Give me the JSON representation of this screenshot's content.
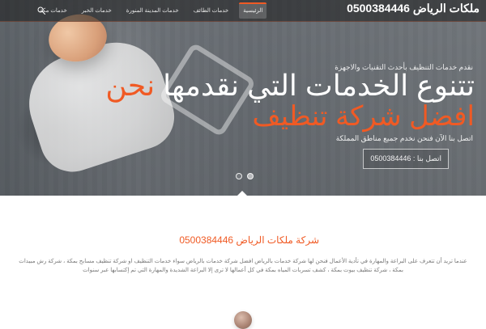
{
  "header": {
    "brand_name": "ملكات الرياض",
    "brand_phone": "0500384446",
    "nav": [
      {
        "label": "الرئيسية",
        "active": true
      },
      {
        "label": "خدمات الطائف",
        "active": false
      },
      {
        "label": "خدمات المدينة المنورة",
        "active": false
      },
      {
        "label": "خدمات الخبر",
        "active": false
      },
      {
        "label": "خدمات مكة",
        "active": false
      }
    ],
    "search_icon": "search-icon"
  },
  "hero": {
    "kicker": "نقدم خدمات التنظيف بأحدث التقنيات والاجهزة",
    "title_line1_pre": "تتنوع الخدمات التي نقدمها ",
    "title_line1_accent": "نحن",
    "title_line2": "افضل شركة تنظيف",
    "subtitle": "اتصل بنا الآن فنحن نخدم جميع مناطق المملكة",
    "cta_label": "اتصل بنا : 0500384446",
    "slider_dots": [
      {
        "active": false
      },
      {
        "active": true
      }
    ]
  },
  "about": {
    "title": "شركة ملكات الرياض 0500384446",
    "paragraph": "عندما تريد أن تتعرف على البراعة والمهارة في تأدية الأعمال فنحن لها شركة خدمات بالرياض افضل شركة خدمات بالرياض سواء خدمات التنظيف او شركة تنظيف مسابح بمكة ، شركة رش مبيدات بمكة ، شركة تنظيف بيوت بمكة ، كشف تسربات المياه بمكة في كل أعمالها لا ترى إلا البراعة الشديدة والمهارة التي تم إكتسابها عبر سنوات"
  },
  "colors": {
    "accent": "#f05a24"
  }
}
